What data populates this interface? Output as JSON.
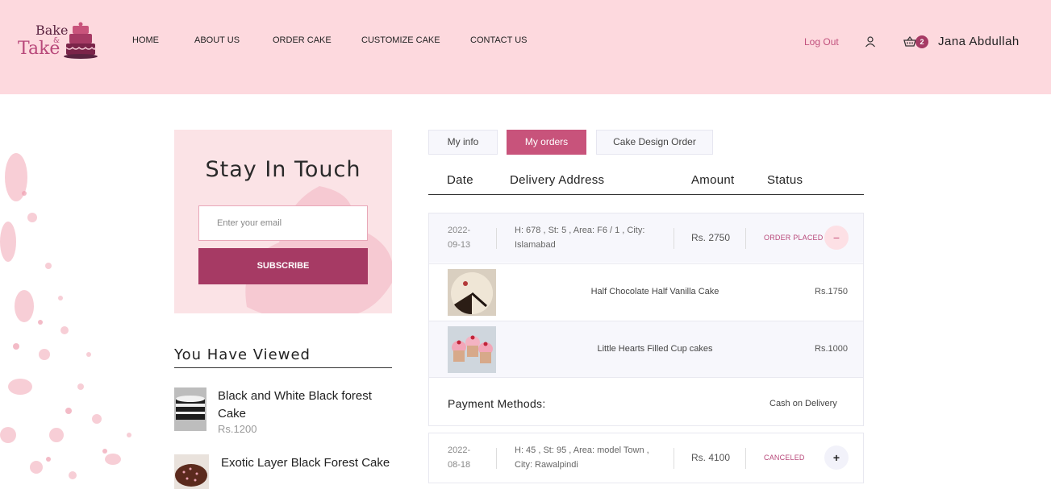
{
  "brand": {
    "word1": "Bake",
    "amp": "&",
    "word2": "Take"
  },
  "nav": {
    "items": [
      "HOME",
      "ABOUT US",
      "ORDER CAKE",
      "CUSTOMIZE CAKE",
      "CONTACT US"
    ]
  },
  "header": {
    "logout": "Log Out",
    "cart_count": "2",
    "username": "Jana Abdullah"
  },
  "newsletter": {
    "title": "Stay In Touch",
    "email_placeholder": "Enter your email",
    "subscribe_label": "SUBSCRIBE"
  },
  "viewed": {
    "title": "You Have Viewed",
    "items": [
      {
        "name": "Black and White Black forest Cake",
        "price": "Rs.1200"
      },
      {
        "name": "Exotic Layer Black Forest Cake",
        "price": ""
      }
    ]
  },
  "tabs": [
    "My info",
    "My orders",
    "Cake Design Order"
  ],
  "table_headers": [
    "Date",
    "Delivery Address",
    "Amount",
    "Status"
  ],
  "orders": [
    {
      "date_line1": "2022-",
      "date_line2": "09-13",
      "address": "H: 678 , St: 5 , Area: F6 / 1 , City: Islamabad",
      "amount": "Rs. 2750",
      "status": "ORDER PLACED",
      "toggle": "−",
      "items": [
        {
          "name": "Half Chocolate Half Vanilla Cake",
          "price": "Rs.1750"
        },
        {
          "name": "Little Hearts Filled Cup cakes",
          "price": "Rs.1000"
        }
      ],
      "payment_label": "Payment Methods:",
      "payment_value": "Cash on Delivery"
    },
    {
      "date_line1": "2022-",
      "date_line2": "08-18",
      "address": "H: 45 , St: 95 , Area: model Town , City: Rawalpindi",
      "amount": "Rs. 4100",
      "status": "CANCELED",
      "toggle": "+"
    }
  ],
  "colors": {
    "header_bg": "#fdd9de",
    "accent": "#c8537b",
    "button": "#a63a64"
  }
}
